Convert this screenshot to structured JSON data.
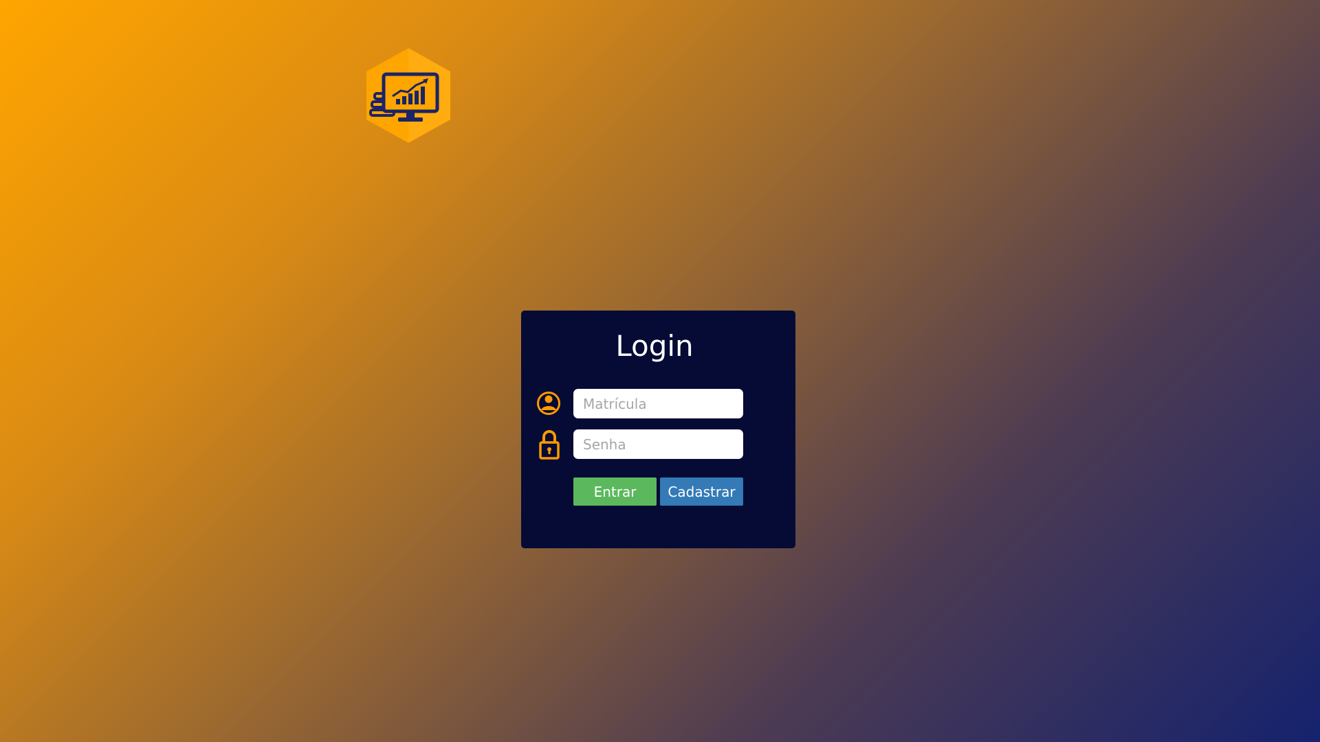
{
  "logo": {
    "icon": "hexagon-monitor-chart-icon",
    "color": "#ffa500",
    "icon_color": "#1b2466"
  },
  "login": {
    "title": "Login",
    "matricula": {
      "placeholder": "Matrícula",
      "icon": "user-icon"
    },
    "senha": {
      "placeholder": "Senha",
      "icon": "lock-icon"
    },
    "entrar_label": "Entrar",
    "cadastrar_label": "Cadastrar"
  },
  "colors": {
    "card_background": "#050b35",
    "accent": "#ff9a00",
    "entrar_button": "#5cb85c",
    "cadastrar_button": "#337ab7"
  }
}
